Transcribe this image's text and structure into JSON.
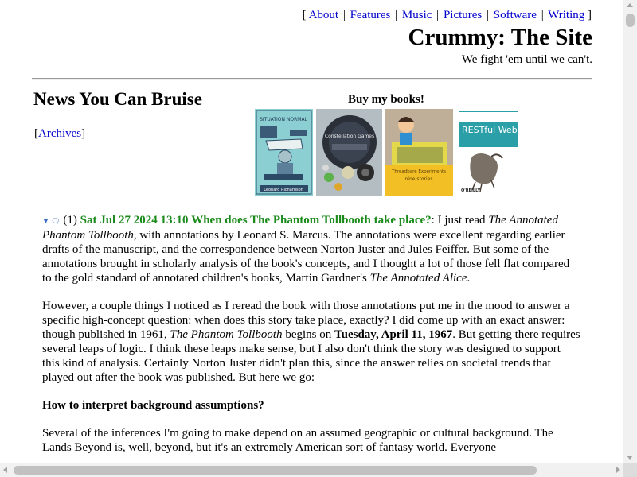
{
  "nav": {
    "open_bracket": "[",
    "close_bracket": "]",
    "separator": "|",
    "links": [
      "About",
      "Features",
      "Music",
      "Pictures",
      "Software",
      "Writing"
    ]
  },
  "site": {
    "title": "Crummy: The Site",
    "tagline": "We fight 'em until we can't."
  },
  "news": {
    "heading": "News You Can Bruise",
    "archives_open": "[",
    "archives_label": "Archives",
    "archives_close": "]"
  },
  "books": {
    "heading": "Buy my books!",
    "covers": [
      {
        "title": "SITUATION NORMAL",
        "author": "Leonard Richardson"
      },
      {
        "title": "Constellation Games"
      },
      {
        "title": "Threadbare Experiments",
        "subtitle": "nine stories"
      },
      {
        "title": "RESTful Web APIs",
        "publisher": "O'REILLY"
      }
    ]
  },
  "post": {
    "count": "(1)",
    "date": "Sat Jul 27 2024 13:10",
    "title": "When does The Phantom Tollbooth take place?",
    "p1": {
      "a": ": I just read ",
      "b": "The Annotated Phantom Tollbooth",
      "c": ", with annotations by Leonard S. Marcus. The annotations were excellent regarding earlier drafts of the manuscript, and the correspondence between Norton Juster and Jules Feiffer. But some of the annotations brought in scholarly analysis of the book's concepts, and I thought a lot of those fell flat compared to the gold standard of annotated children's books, Martin Gardner's ",
      "d": "The Annotated Alice",
      "e": "."
    },
    "p2": {
      "a": "However, a couple things I noticed as I reread the book with those annotations put me in the mood to answer a specific high-concept question: when does this story take place, exactly? I did come up with an exact answer: though published in 1961, ",
      "b": "The Phantom Tollbooth",
      "c": " begins on ",
      "d": "Tuesday, April 11, 1967",
      "e": ". But getting there requires several leaps of logic. I think these leaps make sense, but I also don't think the story was designed to support this kind of analysis. Certainly Norton Juster didn't plan this, since the answer relies on societal trends that played out after the book was published. But here we go:"
    },
    "section_heading": "How to interpret background assumptions?",
    "p3": "Several of the inferences I'm going to make depend on an assumed geographic or cultural background. The Lands Beyond is, well, beyond, but it's an extremely American sort of fantasy world. Everyone"
  },
  "colors": {
    "link": "#0000cc",
    "post_title": "#1a8a1a",
    "icon": "#3a6ebd"
  }
}
